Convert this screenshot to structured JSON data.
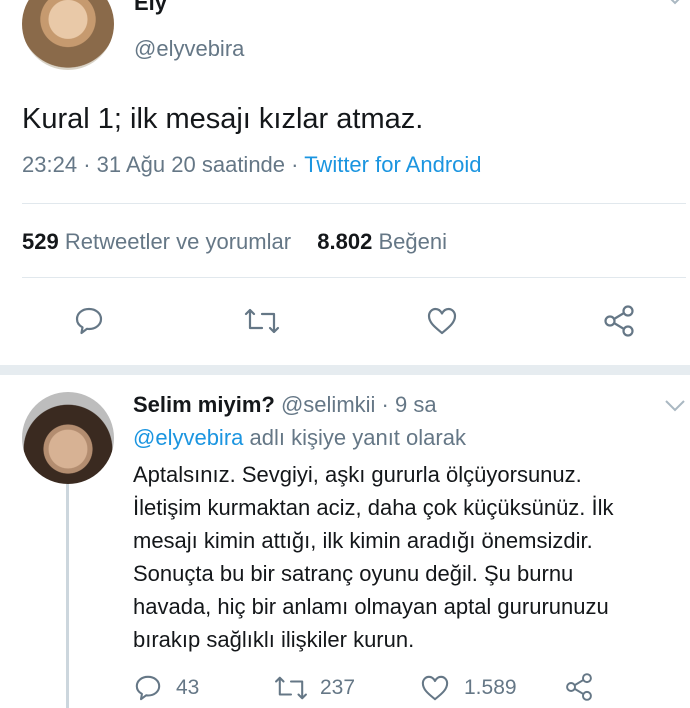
{
  "original_tweet": {
    "display_name": "Ely",
    "handle": "@elyvebira",
    "text": "Kural 1; ilk mesajı kızlar atmaz.",
    "time": "23:24",
    "date": "31 Ağu 20 saatinde",
    "meta_separator": "·",
    "source": "Twitter for Android",
    "retweets_count": "529",
    "retweets_label": "Retweetler ve yorumlar",
    "likes_count": "8.802",
    "likes_label": "Beğeni"
  },
  "reply": {
    "display_name": "Selim miyim?",
    "handle": "@selimkii",
    "age": "· 9 sa",
    "reply_to_mention": "@elyvebira",
    "reply_to_suffix": "adlı kişiye yanıt olarak",
    "text_lines": [
      "Aptalsınız. Sevgiyi, aşkı gururla ölçüyorsunuz.",
      "İletişim kurmaktan aciz, daha çok küçüksünüz. İlk",
      "mesajı kimin attığı, ilk kimin aradığı önemsizdir.",
      "Sonuçta bu bir satranç oyunu değil. Şu burnu",
      "havada, hiç bir anlamı olmayan aptal gururunuzu",
      "bırakıp sağlıklı ilişkiler kurun."
    ],
    "reply_count": "43",
    "retweet_count": "237",
    "like_count": "1.589"
  },
  "icons": [
    "reply-icon",
    "retweet-icon",
    "like-icon",
    "share-icon",
    "chevron-down-icon"
  ],
  "colors": {
    "text": "#14171a",
    "secondary": "#657786",
    "link": "#1b95e0",
    "divider": "#e1e8ed",
    "separator": "#e6ecf0"
  }
}
